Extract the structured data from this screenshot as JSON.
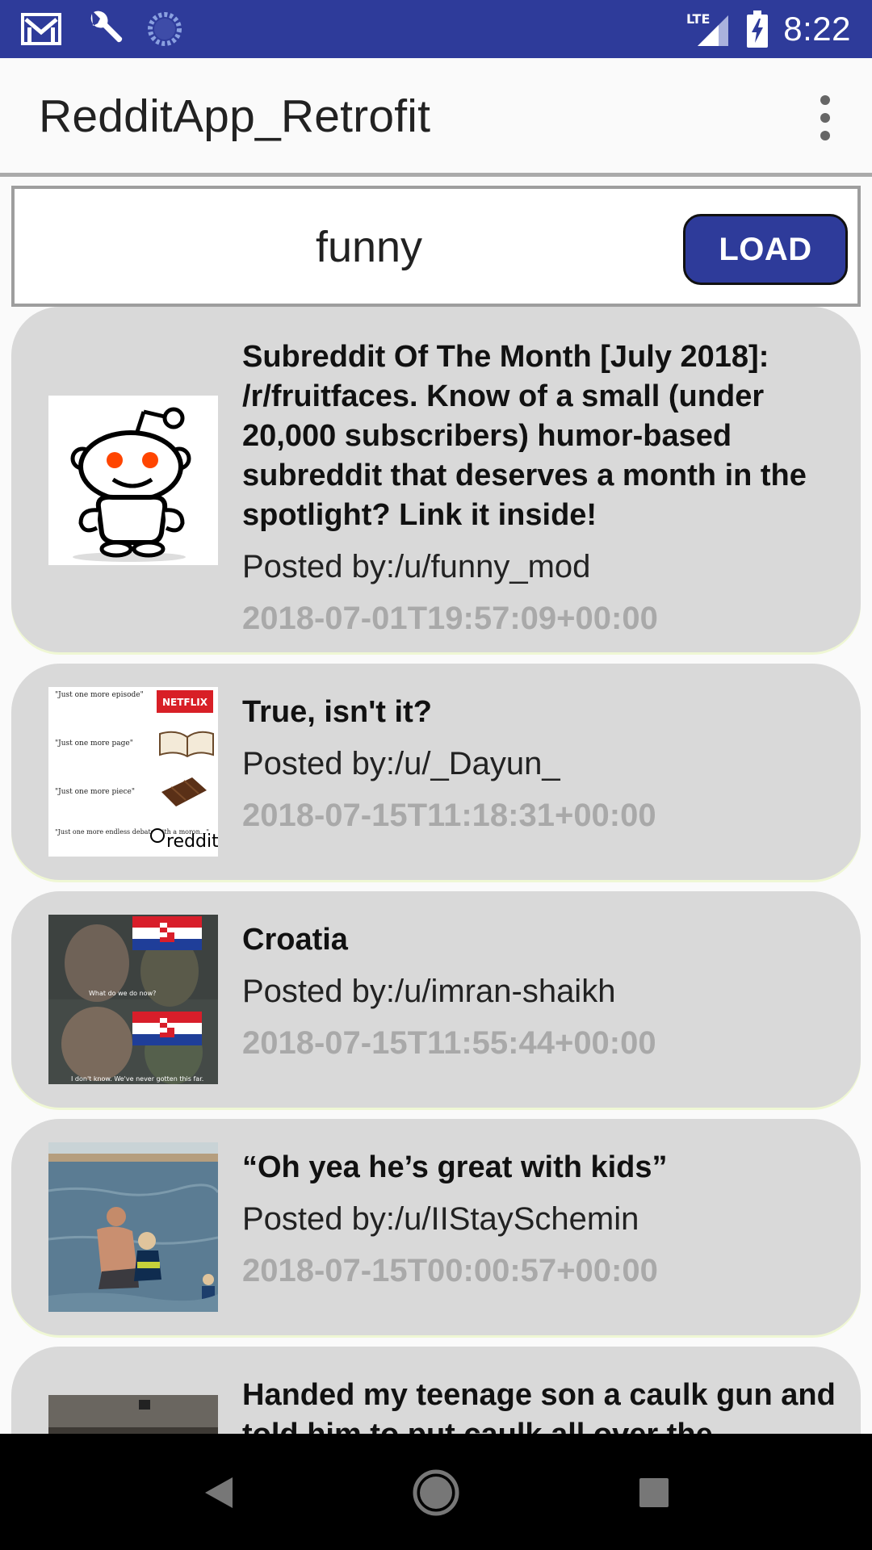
{
  "status_bar": {
    "time": "8:22",
    "network": "LTE",
    "icons": [
      "gmail-icon",
      "wrench-icon",
      "sync-icon",
      "signal-icon",
      "battery-charging-icon"
    ]
  },
  "app_bar": {
    "title": "RedditApp_Retrofit",
    "overflow_icon": "more-vert-icon"
  },
  "search": {
    "value": "funny",
    "load_label": "LOAD"
  },
  "posts": [
    {
      "title": "Subreddit Of The Month [July 2018]: /r/fruitfaces. Know of a small (under 20,000 subscribers) humor-based subreddit that deserves a month in the spotlight? Link it inside!",
      "author": "Posted by:/u/funny_mod",
      "date": "2018-07-01T19:57:09+00:00",
      "thumb": "reddit-alien-thumbnail"
    },
    {
      "title": "True, isn't it?",
      "author": "Posted by:/u/_Dayun_",
      "date": "2018-07-15T11:18:31+00:00",
      "thumb": "meme-just-one-more-thumbnail",
      "thumb_texts": [
        "\"Just one more episode\"",
        "\"Just one more page\"",
        "\"Just one more piece\"",
        "\"Just one more endless debate with a moron...\""
      ],
      "thumb_brand": "reddit",
      "thumb_netflix": "NETFLIX"
    },
    {
      "title": "Croatia",
      "author": "Posted by:/u/imran-shaikh",
      "date": "2018-07-15T11:55:44+00:00",
      "thumb": "croatia-meme-thumbnail",
      "thumb_caption1": "What do we do now?",
      "thumb_caption2": "I don't know. We've never gotten this far."
    },
    {
      "title": "“Oh yea he’s great with kids”",
      "author": "Posted by:/u/IIStaySchemin",
      "date": "2018-07-15T00:00:57+00:00",
      "thumb": "beach-kids-thumbnail"
    },
    {
      "title": "Handed my teenage son a caulk gun and told him to put caulk all over the",
      "author": "",
      "date": "",
      "thumb": "caulk-thumbnail"
    }
  ],
  "nav_bar": {
    "icons": [
      "back-icon",
      "home-icon",
      "recents-icon"
    ]
  },
  "colors": {
    "primary": "#2e3b9a",
    "card": "#d9d9d9",
    "date_text": "#a9a9a9"
  }
}
